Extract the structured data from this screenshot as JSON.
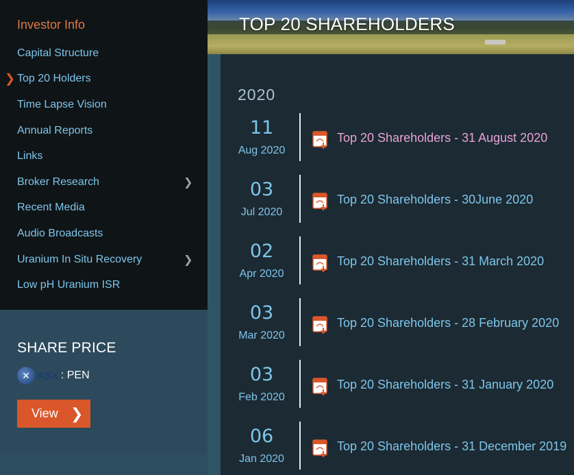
{
  "sidebar": {
    "heading": "Investor Info",
    "items": [
      {
        "label": "Capital Structure"
      },
      {
        "label": "Top 20 Holders",
        "active_marker": "❯"
      },
      {
        "label": "Time Lapse Vision"
      },
      {
        "label": "Annual Reports"
      },
      {
        "label": "Links"
      },
      {
        "label": "Broker Research",
        "submenu_marker": "❯"
      },
      {
        "label": "Recent Media"
      },
      {
        "label": "Audio Broadcasts"
      },
      {
        "label": "Uranium In Situ Recovery",
        "submenu_marker": "❯"
      },
      {
        "label": "Low pH Uranium ISR"
      }
    ]
  },
  "share_price": {
    "title": "SHARE PRICE",
    "exchange_logo_text": "ASX",
    "code": ": PEN",
    "view_button": "View",
    "view_chevron": "❯"
  },
  "banner": {
    "title": "TOP 20 SHAREHOLDERS"
  },
  "year": "2020",
  "entries": [
    {
      "day": "11",
      "month": "Aug 2020",
      "title": "Top 20 Shareholders - 31 August 2020",
      "visited": true
    },
    {
      "day": "03",
      "month": "Jul 2020",
      "title": " Top 20 Shareholders - 30June 2020",
      "visited": false
    },
    {
      "day": "02",
      "month": "Apr 2020",
      "title": "Top 20 Shareholders - 31 March 2020",
      "visited": false
    },
    {
      "day": "03",
      "month": "Mar 2020",
      "title": "Top 20 Shareholders - 28 February 2020",
      "visited": false
    },
    {
      "day": "03",
      "month": "Feb 2020",
      "title": "Top 20 Shareholders - 31 January 2020",
      "visited": false
    },
    {
      "day": "06",
      "month": "Jan 2020",
      "title": "Top 20 Shareholders - 31 December 2019",
      "visited": false
    }
  ],
  "colors": {
    "accent": "#d9572a",
    "link": "#7ec6ea",
    "visited_link": "#e7a3d7",
    "sidebar_bg": "#0f1417",
    "panel_bg": "#2c4a5c",
    "main_bg": "#1c2a33"
  },
  "icons": {
    "entry_icon": "pdf-download-icon"
  }
}
